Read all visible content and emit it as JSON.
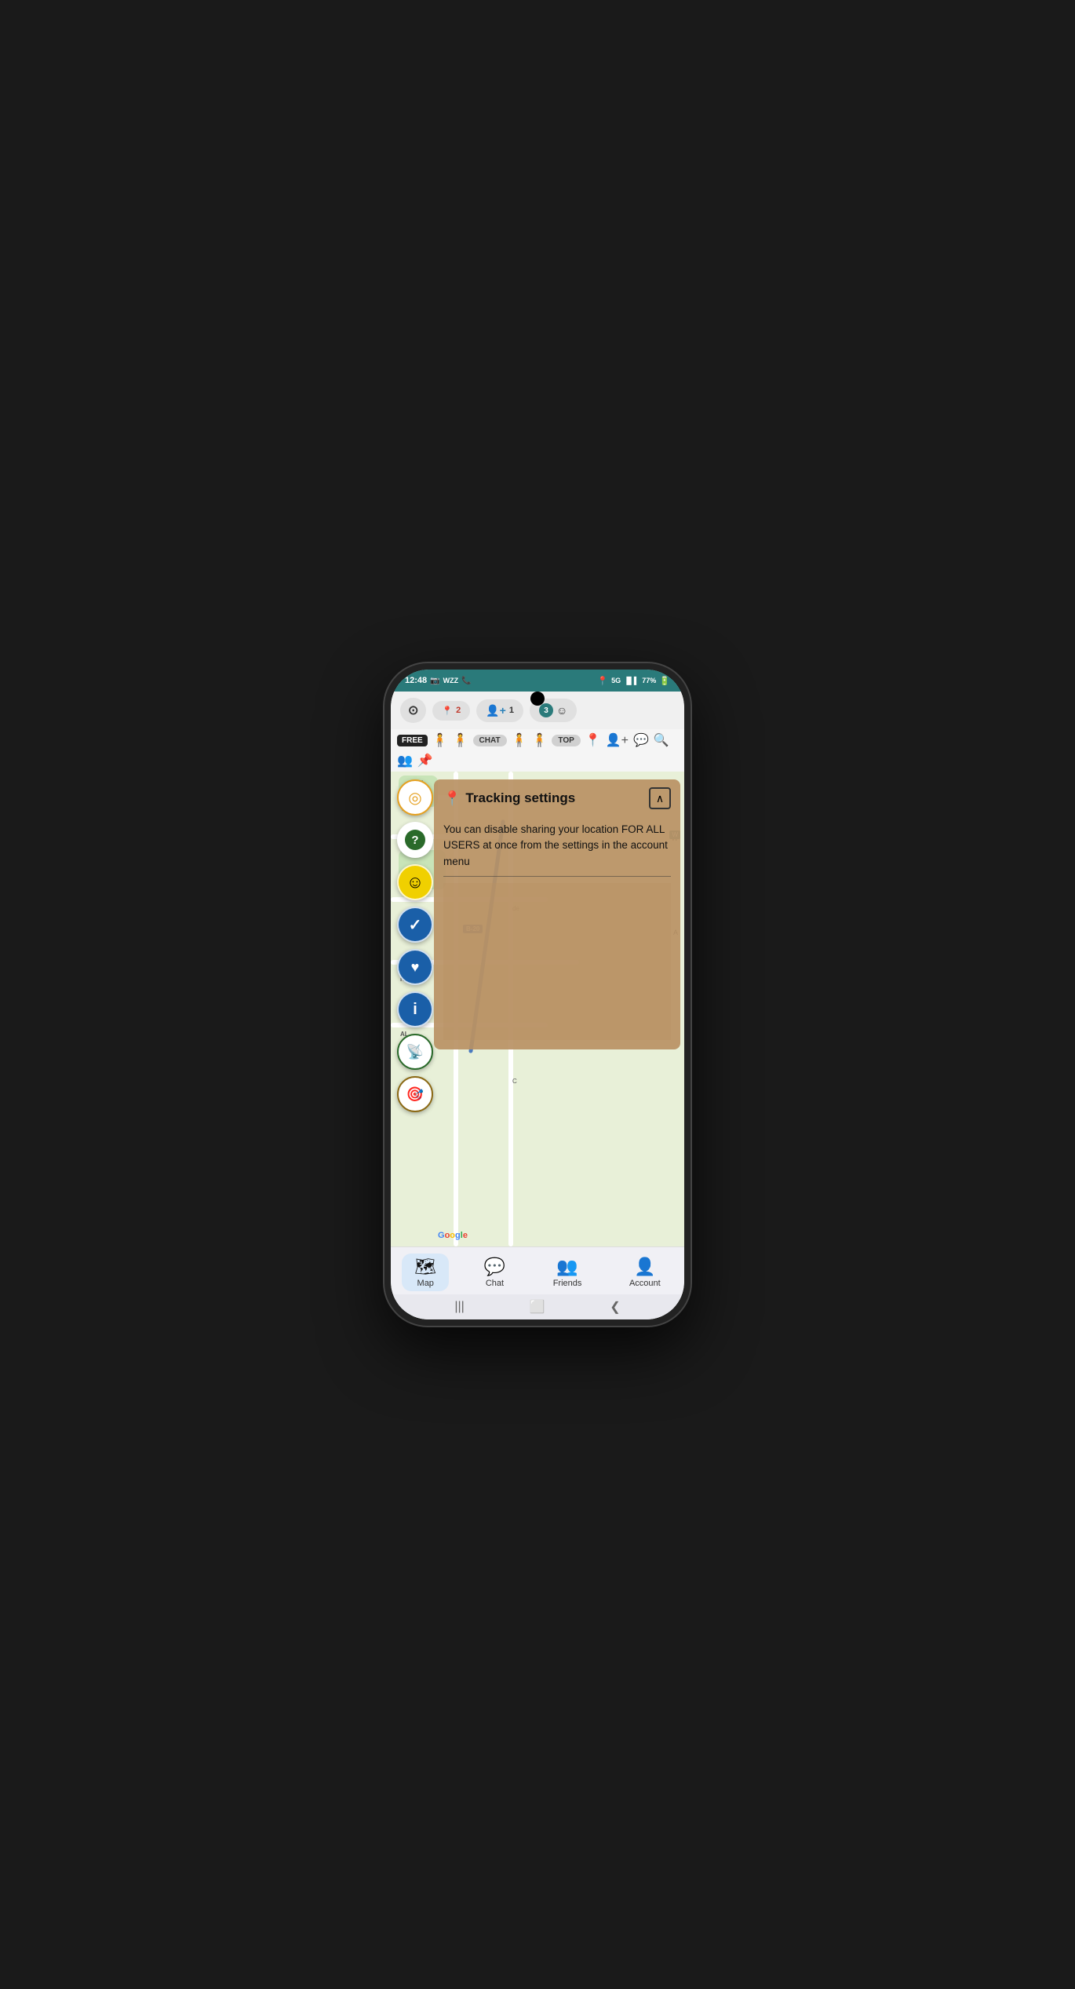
{
  "status_bar": {
    "time": "12:48",
    "carrier": "WZZ",
    "network": "5G",
    "battery": "77%"
  },
  "top_buttons": {
    "camera_icon": "⊙",
    "location_count": "2",
    "add_friend": "+👤 1",
    "notifications": "3"
  },
  "toolbar": {
    "free_label": "FREE",
    "chat_label": "CHAT",
    "top_label": "TOP"
  },
  "tracking_panel": {
    "title": "Tracking settings",
    "description": "You can disable sharing your location FOR ALL USERS at once from the settings in the account menu",
    "close_icon": "∧"
  },
  "left_buttons": [
    {
      "id": "location",
      "icon": "◎",
      "color": "#e5a020"
    },
    {
      "id": "help",
      "icon": "?"
    },
    {
      "id": "emoji",
      "icon": "☺"
    },
    {
      "id": "check",
      "icon": "✓"
    },
    {
      "id": "heart",
      "icon": "♥"
    },
    {
      "id": "info",
      "icon": "ℹ"
    },
    {
      "id": "signal",
      "icon": "📡"
    },
    {
      "id": "target",
      "icon": "◎"
    }
  ],
  "bottom_nav": {
    "items": [
      {
        "id": "map",
        "icon": "🗺",
        "label": "Map",
        "active": true
      },
      {
        "id": "chat",
        "icon": "💬",
        "label": "Chat",
        "active": false
      },
      {
        "id": "friends",
        "icon": "👥",
        "label": "Friends",
        "active": false
      },
      {
        "id": "account",
        "icon": "👤",
        "label": "Account",
        "active": false
      }
    ]
  },
  "google_label": "Google",
  "gesture_bar": {
    "back": "❮",
    "home": "⬜",
    "recent": "|||"
  }
}
